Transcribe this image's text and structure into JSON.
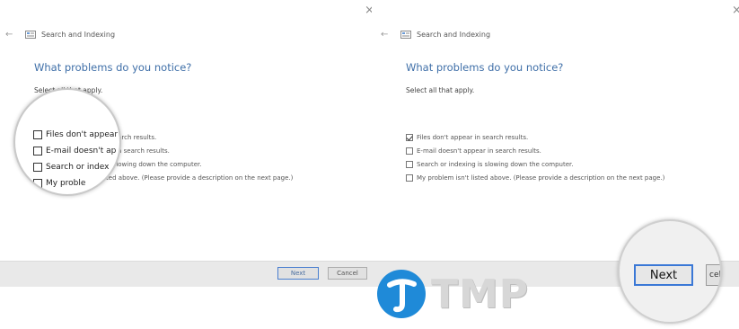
{
  "window": {
    "close_glyph": "×"
  },
  "left": {
    "title": "Search and Indexing",
    "heading": "What problems do you notice?",
    "subtext": "Select all that apply.",
    "options": [
      {
        "label": "Files don't appear in search results.",
        "checked": false
      },
      {
        "label": "E-mail doesn't appear in search results.",
        "checked": false
      },
      {
        "label": "Search or indexing is slowing down the computer.",
        "checked": false
      },
      {
        "label": "My problem isn't listed above. (Please provide a description on the next page.)",
        "checked": false
      }
    ],
    "next_label": "Next",
    "cancel_label": "Cancel"
  },
  "right": {
    "title": "Search and Indexing",
    "heading": "What problems do you notice?",
    "subtext": "Select all that apply.",
    "options": [
      {
        "label": "Files don't appear in search results.",
        "checked": true
      },
      {
        "label": "E-mail doesn't appear in search results.",
        "checked": false
      },
      {
        "label": "Search or indexing is slowing down the computer.",
        "checked": false
      },
      {
        "label": "My problem isn't listed above. (Please provide a description on the next page.)",
        "checked": false
      }
    ]
  },
  "magnifier_left": {
    "items": [
      "Files don't appear",
      "E-mail doesn't ap",
      "Search or index",
      "My proble"
    ]
  },
  "magnifier_right": {
    "next_label": "Next",
    "cancel_label": "cel"
  },
  "logo": {
    "text": "TMP",
    "circle_color": "#1f8ad8"
  }
}
